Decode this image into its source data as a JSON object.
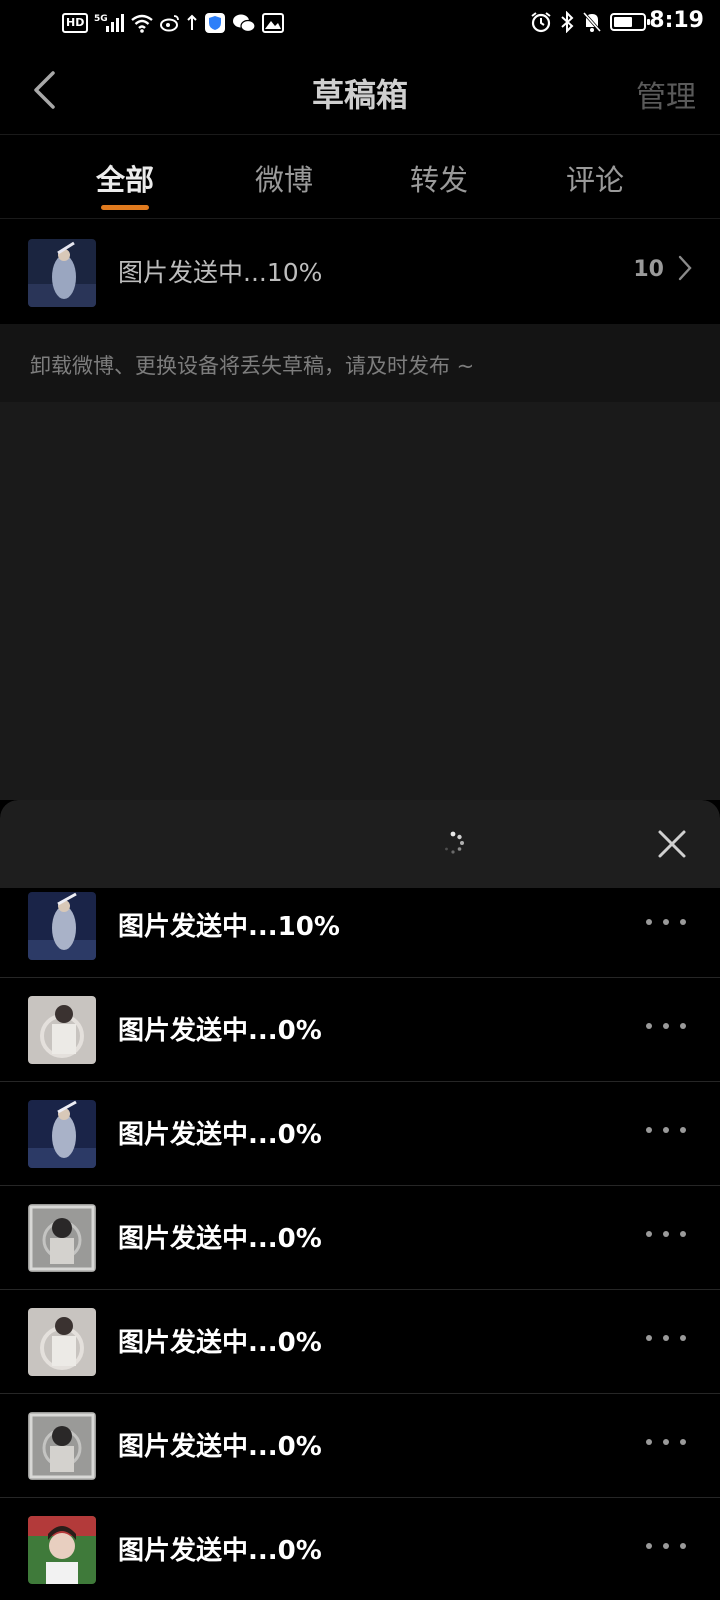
{
  "status_bar": {
    "left_icons": [
      "hd-icon",
      "5g-signal-icon",
      "wifi-icon",
      "weibo-icon",
      "upload-arrow-icon",
      "shield-icon",
      "wechat-icon",
      "gallery-icon"
    ],
    "right_icons": [
      "alarm-icon",
      "bluetooth-icon",
      "mute-bell-icon",
      "battery-icon"
    ],
    "time": "8:19"
  },
  "header": {
    "title": "草稿箱",
    "manage_label": "管理"
  },
  "tabs": [
    {
      "label": "全部",
      "active": true
    },
    {
      "label": "微博",
      "active": false
    },
    {
      "label": "转发",
      "active": false
    },
    {
      "label": "评论",
      "active": false
    }
  ],
  "summary": {
    "text": "图片发送中...10%",
    "count": "10"
  },
  "tip": "卸载微博、更换设备将丢失草稿，请及时发布 ~",
  "sheet": {
    "items": [
      {
        "text": "图片发送中...10%"
      },
      {
        "text": "图片发送中...0%"
      },
      {
        "text": "图片发送中...0%"
      },
      {
        "text": "图片发送中...0%"
      },
      {
        "text": "图片发送中...0%"
      },
      {
        "text": "图片发送中...0%"
      },
      {
        "text": "图片发送中...0%"
      }
    ]
  },
  "colors": {
    "accent": "#e07a1e",
    "background": "#000000",
    "empty_area": "#1a1a1a",
    "sheet_header": "#1e1e1e"
  }
}
